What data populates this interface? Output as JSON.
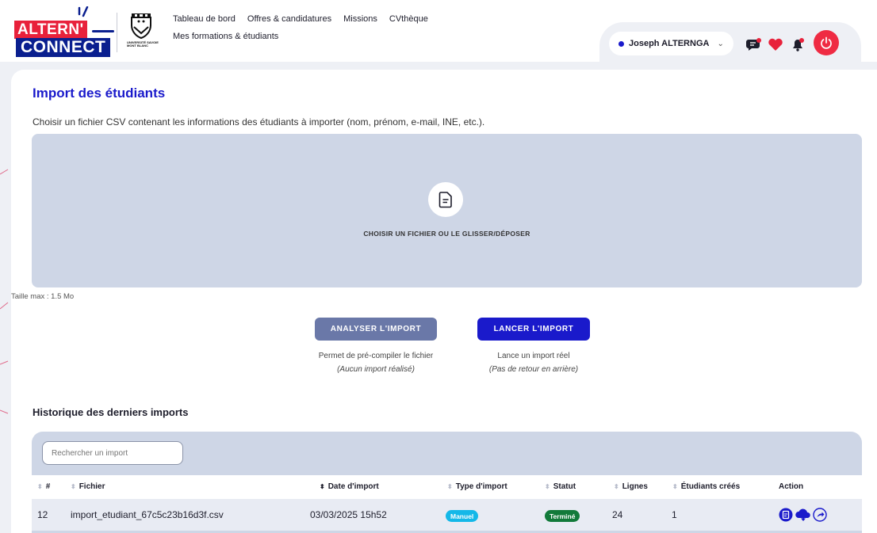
{
  "logo": {
    "line1": "ALTERN'",
    "line2": "CONNECT",
    "university": "UNIVERSITÉ SAVOIE MONT BLANC"
  },
  "nav": {
    "items": [
      "Tableau de bord",
      "Offres & candidatures",
      "Missions",
      "CVthèque"
    ],
    "second_row": "Mes formations & étudiants"
  },
  "user": {
    "name": "Joseph ALTERNGA",
    "chevron": "⌄"
  },
  "page": {
    "title": "Import des étudiants",
    "description": "Choisir un fichier CSV contenant les informations des étudiants à importer (nom, prénom, e-mail, INE, etc.).",
    "dropzone_label": "CHOISIR UN FICHIER OU LE GLISSER/DÉPOSER",
    "max_size": "Taille max : 1.5 Mo"
  },
  "actions": {
    "analyse_label": "ANALYSER L'IMPORT",
    "analyse_hint": "Permet de pré-compiler le fichier",
    "analyse_hint2": "(Aucun import réalisé)",
    "launch_label": "LANCER L'IMPORT",
    "launch_hint": "Lance un import réel",
    "launch_hint2": "(Pas de retour en arrière)"
  },
  "history": {
    "title": "Historique des derniers imports",
    "search_placeholder": "Rechercher un import",
    "columns": [
      "#",
      "Fichier",
      "Date d'import",
      "Type d'import",
      "Statut",
      "Lignes",
      "Étudiants créés",
      "Action"
    ],
    "rows": [
      {
        "id": "12",
        "file": "import_etudiant_67c5c23b16d3f.csv",
        "date": "03/03/2025 15h52",
        "type": "Manuel",
        "status": "Terminé",
        "lines": "24",
        "created": "1"
      }
    ]
  },
  "colors": {
    "primary": "#1a1acb",
    "brand_red": "#e8213b",
    "brand_navy": "#0a1f8f",
    "dropzone": "#ced6e6",
    "badge_manuel": "#14b8e8",
    "badge_termine": "#127a3a"
  },
  "icons": [
    "file-icon",
    "chat-icon",
    "heart-icon",
    "bell-icon",
    "power-icon",
    "document-icon",
    "cloud-download-icon",
    "share-icon"
  ]
}
